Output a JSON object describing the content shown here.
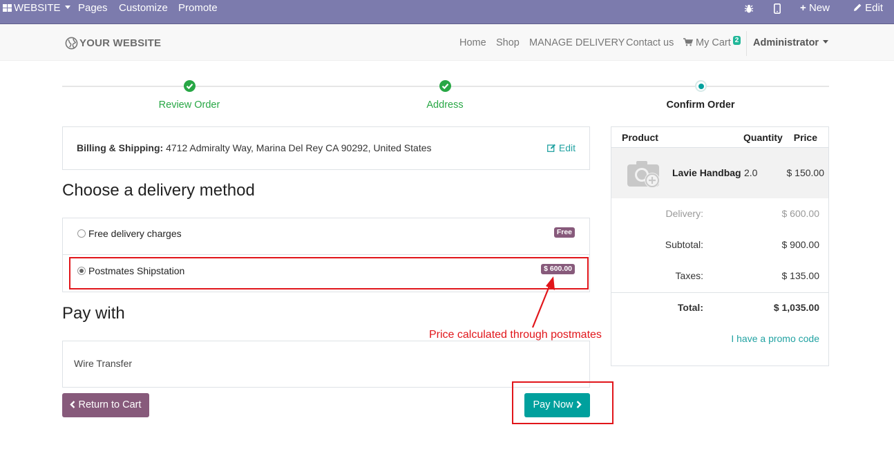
{
  "topbar": {
    "website": "WEBSITE",
    "pages": "Pages",
    "customize": "Customize",
    "promote": "Promote",
    "new": "New",
    "edit": "Edit"
  },
  "header": {
    "logo": "YOUR WEBSITE",
    "nav": [
      "Home",
      "Shop",
      "MANAGE DELIVERY",
      "Contact us"
    ],
    "cart_label": "My Cart",
    "cart_count": "2",
    "user": "Administrator"
  },
  "steps": [
    "Review Order",
    "Address",
    "Confirm Order"
  ],
  "billing": {
    "label": "Billing & Shipping:",
    "address": "4712 Admiralty Way, Marina Del Rey CA 90292, United States",
    "edit": "Edit"
  },
  "delivery": {
    "title": "Choose a delivery method",
    "methods": [
      {
        "label": "Free delivery charges",
        "badge": "Free",
        "selected": false
      },
      {
        "label": "Postmates Shipstation",
        "badge": "$ 600.00",
        "selected": true
      }
    ]
  },
  "annotation": "Price calculated through postmates",
  "payment": {
    "title": "Pay with",
    "method": "Wire Transfer"
  },
  "buttons": {
    "return": "Return to Cart",
    "pay": "Pay Now"
  },
  "summary": {
    "headers": {
      "product": "Product",
      "quantity": "Quantity",
      "price": "Price"
    },
    "item": {
      "name": "Lavie Handbag",
      "qty": "2.0",
      "price": "$ 150.00"
    },
    "delivery_label": "Delivery:",
    "delivery_value": "$ 600.00",
    "subtotal_label": "Subtotal:",
    "subtotal_value": "$ 900.00",
    "taxes_label": "Taxes:",
    "taxes_value": "$ 135.00",
    "total_label": "Total:",
    "total_value": "$ 1,035.00",
    "promo": "I have a promo code"
  },
  "colors": {
    "topbar": "#7c7bad",
    "primary": "#00a09d",
    "secondary": "#875a7b",
    "success": "#28a745",
    "annotation": "#e1151a"
  }
}
